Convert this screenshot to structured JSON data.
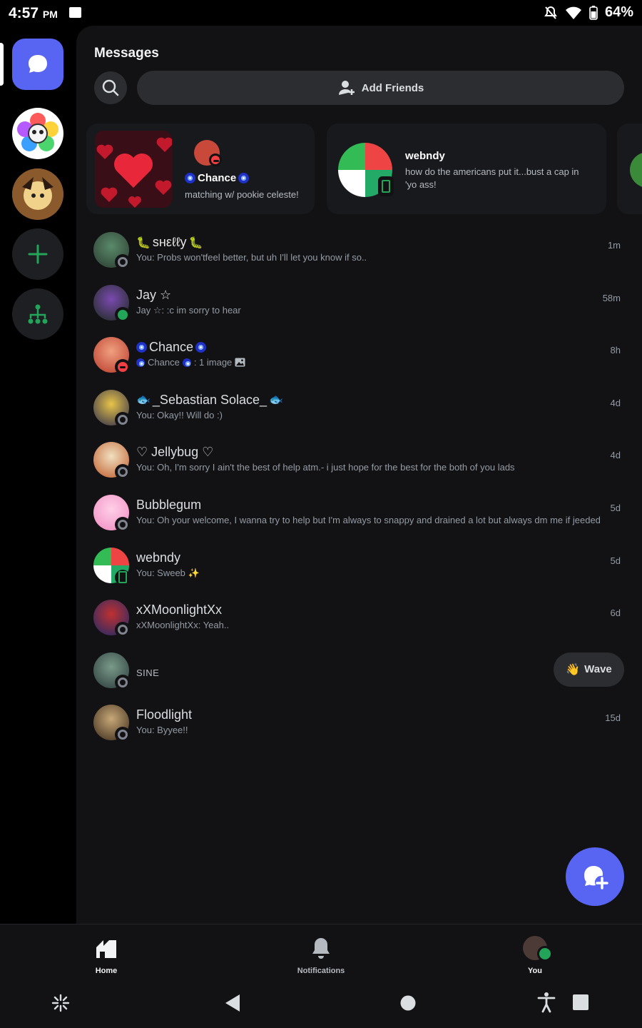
{
  "status_bar": {
    "time": "4:57",
    "ampm": "PM",
    "battery": "64%"
  },
  "header": {
    "title": "Messages",
    "add_friends_label": "Add Friends"
  },
  "status_cards": [
    {
      "name": "Chance",
      "text": "matching w/ pookie celeste!"
    },
    {
      "name": "webndy",
      "text": "how do the americans put it...bust a cap in 'yo ass!"
    }
  ],
  "dms": [
    {
      "name": "sнεℓℓy",
      "preview": "You: Probs won'tfeel better, but uh I'll let you know if so..",
      "time": "1m",
      "status": "offline"
    },
    {
      "name": "Jay ☆",
      "preview": "Jay ☆: :c im sorry to hear",
      "time": "58m",
      "status": "online"
    },
    {
      "name": "Chance",
      "preview_name": "Chance",
      "preview": ": 1 image",
      "time": "8h",
      "status": "dnd"
    },
    {
      "name": "_Sebastian Solace_",
      "preview": "You: Okay!! Will do :)",
      "time": "4d",
      "status": "offline"
    },
    {
      "name": "♡ Jellybug ♡",
      "preview": "You: Oh, I'm sorry I ain't the best of help atm.- i just hope for the best for the both of you lads",
      "time": "4d",
      "status": "offline"
    },
    {
      "name": "Bubblegum",
      "preview": "You: Oh your welcome, I wanna try to help but I'm always to snappy and drained a lot but always dm me if jeeded",
      "time": "5d",
      "status": "offline"
    },
    {
      "name": "webndy",
      "preview": "You: Sweeb",
      "time": "5d",
      "status": "mobile"
    },
    {
      "name": "xXMoonlightXx",
      "preview": "xXMoonlightXx: Yeah..",
      "time": "6d",
      "status": "offline"
    },
    {
      "name": "SINE",
      "wave_label": "Wave",
      "status": "offline"
    },
    {
      "name": "Floodlight",
      "preview": "You: Byyee!!",
      "time": "15d",
      "status": "offline"
    }
  ],
  "bottom_nav": {
    "home": "Home",
    "notifications": "Notifications",
    "you": "You"
  },
  "colors": {
    "accent": "#5865f2",
    "online": "#23a559",
    "dnd": "#f23f43",
    "offline": "#80848e",
    "background": "#121214"
  }
}
